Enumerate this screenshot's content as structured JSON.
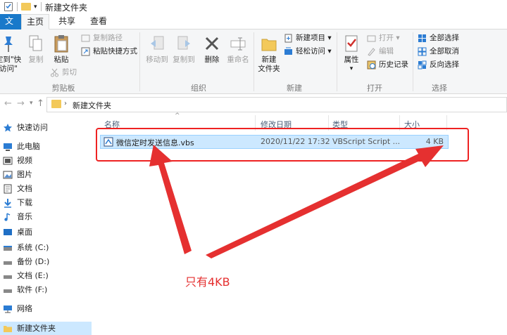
{
  "window": {
    "title": "新建文件夹"
  },
  "tabs": [
    {
      "label": "文件",
      "active": false
    },
    {
      "label": "主页",
      "active": true
    },
    {
      "label": "共享",
      "active": false
    },
    {
      "label": "查看",
      "active": false
    }
  ],
  "ribbon": {
    "clipboard": {
      "pin_label": "定到\"快\n访问\"",
      "copy_label": "复制",
      "paste_label": "粘贴",
      "copy_path_label": "复制路径",
      "paste_shortcut_label": "粘贴快捷方式",
      "cut_label": "剪切",
      "group_label": "剪贴板"
    },
    "organize": {
      "move_to_label": "移动到",
      "copy_to_label": "复制到",
      "delete_label": "删除",
      "rename_label": "重命名",
      "group_label": "组织"
    },
    "new": {
      "new_folder_label": "新建\n文件夹",
      "new_item_label": "新建项目",
      "easy_access_label": "轻松访问",
      "group_label": "新建"
    },
    "open": {
      "properties_label": "属性",
      "open_label": "打开",
      "edit_label": "编辑",
      "history_label": "历史记录",
      "group_label": "打开"
    },
    "select": {
      "select_all_label": "全部选择",
      "select_none_label": "全部取消",
      "invert_label": "反向选择",
      "group_label": "选择"
    }
  },
  "address": {
    "path": "新建文件夹"
  },
  "nav": [
    {
      "label": "快速访问",
      "icon": "star-icon",
      "selected": false
    },
    {
      "label": "此电脑",
      "icon": "computer-icon",
      "selected": false
    },
    {
      "label": "视频",
      "icon": "video-icon",
      "selected": false
    },
    {
      "label": "图片",
      "icon": "picture-icon",
      "selected": false
    },
    {
      "label": "文档",
      "icon": "document-icon",
      "selected": false
    },
    {
      "label": "下载",
      "icon": "download-icon",
      "selected": false
    },
    {
      "label": "音乐",
      "icon": "music-icon",
      "selected": false
    },
    {
      "label": "桌面",
      "icon": "desktop-icon",
      "selected": false
    },
    {
      "label": "系统 (C:)",
      "icon": "drive-icon",
      "selected": false
    },
    {
      "label": "备份 (D:)",
      "icon": "drive-icon",
      "selected": false
    },
    {
      "label": "文档 (E:)",
      "icon": "drive-icon",
      "selected": false
    },
    {
      "label": "软件 (F:)",
      "icon": "drive-icon",
      "selected": false
    },
    {
      "label": "网络",
      "icon": "network-icon",
      "selected": false
    },
    {
      "label": "新建文件夹",
      "icon": "folder-icon",
      "selected": true
    }
  ],
  "columns": {
    "name": "名称",
    "modified": "修改日期",
    "type": "类型",
    "size": "大小"
  },
  "files": [
    {
      "name": "微信定时发送信息.vbs",
      "modified": "2020/11/22 17:32",
      "type": "VBScript Script ...",
      "size": "4 KB"
    }
  ],
  "annotation": {
    "text": "只有4KB",
    "color": "#e53030"
  },
  "colors": {
    "selection": "#cce8ff",
    "highlight_box": "#ee2222",
    "accent": "#1979ca"
  }
}
